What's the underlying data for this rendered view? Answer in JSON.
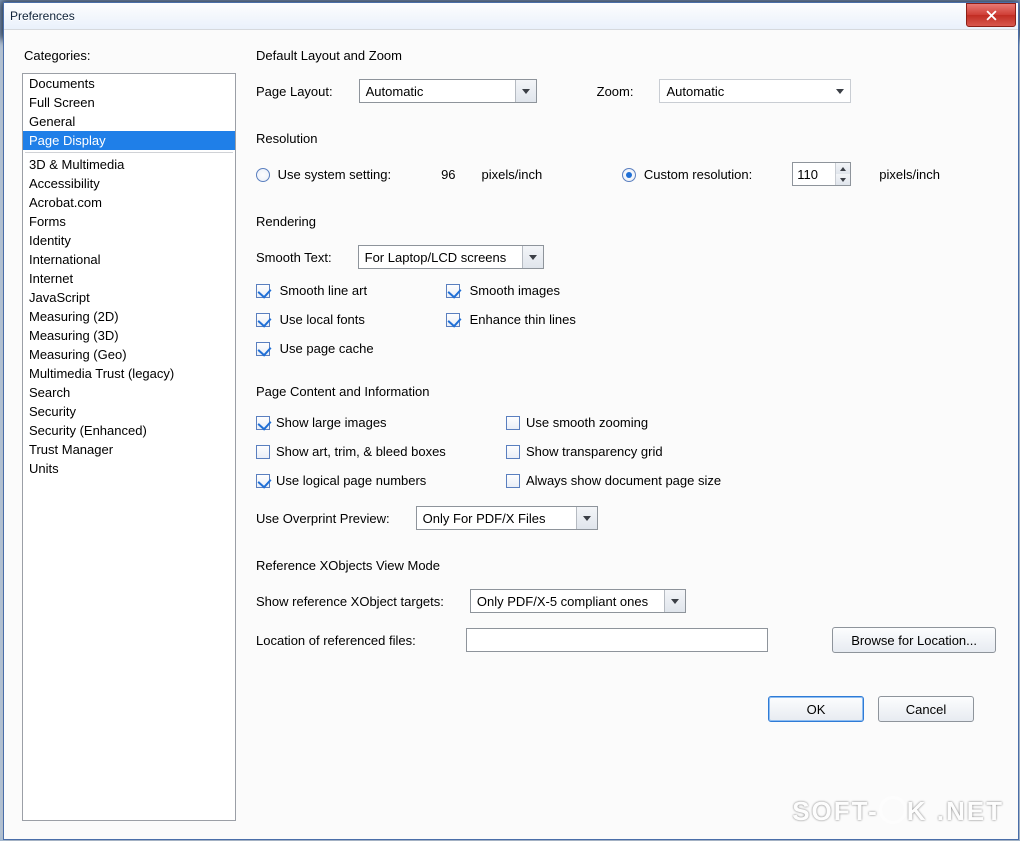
{
  "window": {
    "title": "Preferences"
  },
  "sidebar": {
    "label": "Categories:",
    "groups": [
      [
        "Documents",
        "Full Screen",
        "General",
        "Page Display"
      ],
      [
        "3D & Multimedia",
        "Accessibility",
        "Acrobat.com",
        "Forms",
        "Identity",
        "International",
        "Internet",
        "JavaScript",
        "Measuring (2D)",
        "Measuring (3D)",
        "Measuring (Geo)",
        "Multimedia Trust (legacy)",
        "Search",
        "Security",
        "Security (Enhanced)",
        "Trust Manager",
        "Units"
      ]
    ],
    "selected": "Page Display"
  },
  "layoutZoom": {
    "title": "Default Layout and Zoom",
    "pageLayoutLabel": "Page Layout:",
    "pageLayoutValue": "Automatic",
    "zoomLabel": "Zoom:",
    "zoomValue": "Automatic"
  },
  "resolution": {
    "title": "Resolution",
    "useSystemLabel": "Use system setting:",
    "systemValue": "96",
    "unit": "pixels/inch",
    "customLabel": "Custom resolution:",
    "customValue": "110",
    "selected": "custom"
  },
  "rendering": {
    "title": "Rendering",
    "smoothTextLabel": "Smooth Text:",
    "smoothTextValue": "For Laptop/LCD screens",
    "checks": {
      "smoothLineArt": {
        "label": "Smooth line art",
        "checked": true
      },
      "smoothImages": {
        "label": "Smooth images",
        "checked": true
      },
      "localFonts": {
        "label": "Use local fonts",
        "checked": true
      },
      "enhanceThin": {
        "label": "Enhance thin lines",
        "checked": true
      },
      "pageCache": {
        "label": "Use page cache",
        "checked": true
      }
    }
  },
  "pageContent": {
    "title": "Page Content and Information",
    "checks": {
      "largeImages": {
        "label": "Show large images",
        "checked": true
      },
      "smoothZoom": {
        "label": "Use smooth zooming",
        "checked": false
      },
      "artTrimBleed": {
        "label": "Show art, trim, & bleed boxes",
        "checked": false
      },
      "transGrid": {
        "label": "Show transparency grid",
        "checked": false
      },
      "logicalPages": {
        "label": "Use logical page numbers",
        "checked": true
      },
      "docPageSize": {
        "label": "Always show document page size",
        "checked": false
      }
    },
    "overprintLabel": "Use Overprint Preview:",
    "overprintValue": "Only For PDF/X Files"
  },
  "xobjects": {
    "title": "Reference XObjects View Mode",
    "targetsLabel": "Show reference XObject targets:",
    "targetsValue": "Only PDF/X-5 compliant ones",
    "locationLabel": "Location of referenced files:",
    "locationValue": "",
    "browseLabel": "Browse for Location..."
  },
  "footer": {
    "ok": "OK",
    "cancel": "Cancel"
  },
  "watermark": {
    "left": "SOFT-",
    "right": "K .NET"
  }
}
